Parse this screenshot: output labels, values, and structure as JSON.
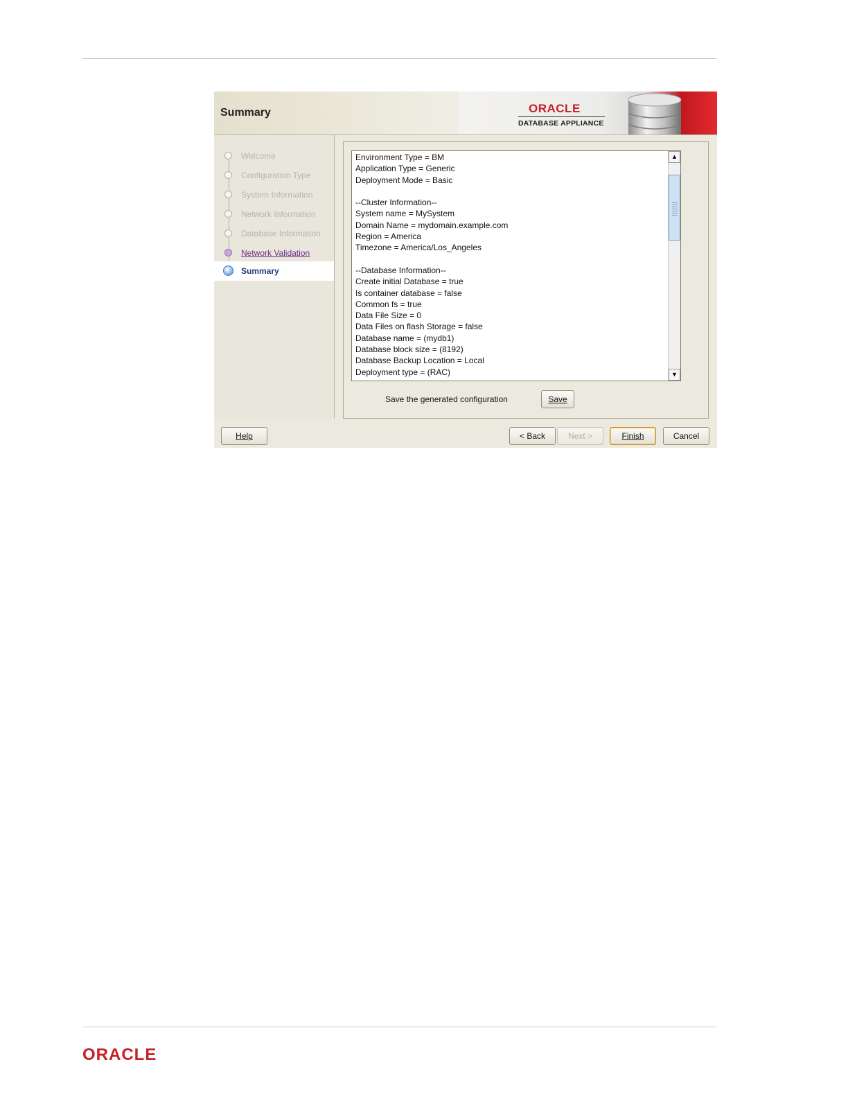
{
  "wizard": {
    "header_title": "Summary",
    "brand_logo": "ORACLE",
    "brand_product": "DATABASE APPLIANCE"
  },
  "nav": {
    "steps": [
      {
        "label": "Welcome",
        "state": "done"
      },
      {
        "label": "Configuration Type",
        "state": "done"
      },
      {
        "label": "System Information",
        "state": "done"
      },
      {
        "label": "Network Information",
        "state": "done"
      },
      {
        "label": "Database Information",
        "state": "done"
      },
      {
        "label": "Network Validation",
        "state": "link"
      },
      {
        "label": "Summary",
        "state": "current"
      }
    ]
  },
  "summary": {
    "lines": [
      "Environment Type = BM",
      "Application Type = Generic",
      "Deployment Mode = Basic",
      "",
      "--Cluster Information--",
      "System name = MySystem",
      "Domain Name = mydomain.example.com",
      "Region = America",
      "Timezone = America/Los_Angeles",
      "",
      "--Database Information--",
      "Create initial Database = true",
      "Is container database = false",
      "Common fs = true",
      "Data File Size = 0",
      "Data Files on flash Storage = false",
      "Database name = (mydb1)",
      "Database block size = (8192)",
      "Database Backup Location = Local",
      "Deployment type = (RAC)"
    ]
  },
  "save_section": {
    "label": "Save the generated configuration",
    "save_button": "Save"
  },
  "buttons": {
    "help": "Help",
    "back": "< Back",
    "next": "Next >",
    "finish": "Finish",
    "cancel": "Cancel"
  },
  "footer": {
    "logo": "ORACLE"
  },
  "colors": {
    "oracle_red": "#c71f25",
    "link_purple": "#6b2d8a",
    "current_step_blue": "#1d3f7a"
  }
}
